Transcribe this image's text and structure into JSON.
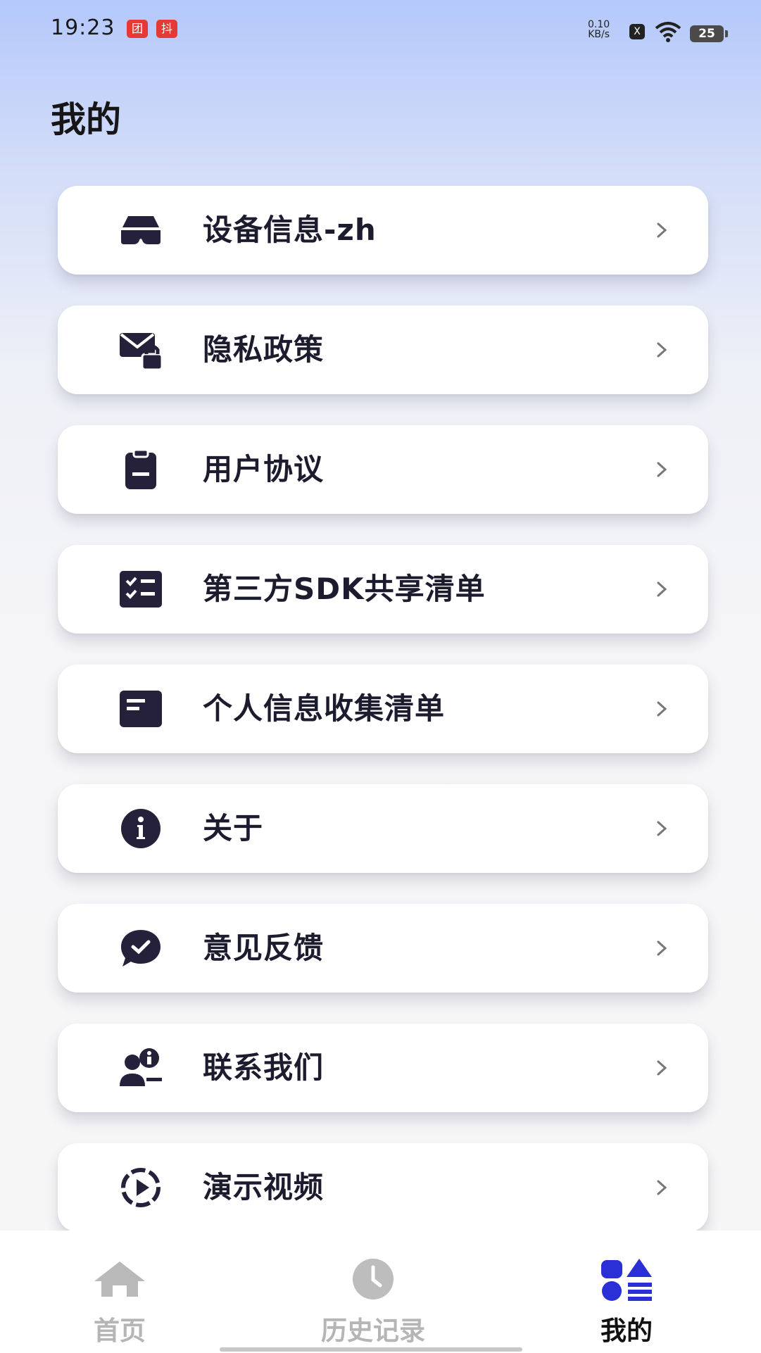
{
  "status_bar": {
    "time": "19:23",
    "notif_badges": [
      "团",
      "抖"
    ],
    "net_speed": "0.10",
    "net_unit": "KB/s",
    "sim_label": "X",
    "battery": "25"
  },
  "page": {
    "title": "我的"
  },
  "menu": [
    {
      "label": "设备信息-zh",
      "icon": "vr-headset-icon"
    },
    {
      "label": "隐私政策",
      "icon": "mail-lock-icon"
    },
    {
      "label": "用户协议",
      "icon": "clipboard-icon"
    },
    {
      "label": "第三方SDK共享清单",
      "icon": "checklist-icon"
    },
    {
      "label": "个人信息收集清单",
      "icon": "document-list-icon"
    },
    {
      "label": "关于",
      "icon": "info-icon"
    },
    {
      "label": "意见反馈",
      "icon": "chat-check-icon"
    },
    {
      "label": "联系我们",
      "icon": "contact-person-icon"
    },
    {
      "label": "演示视频",
      "icon": "video-play-icon"
    }
  ],
  "tabs": [
    {
      "label": "首页",
      "icon": "home-icon",
      "active": false
    },
    {
      "label": "历史记录",
      "icon": "clock-icon",
      "active": false
    },
    {
      "label": "我的",
      "icon": "profile-grid-icon",
      "active": true
    }
  ],
  "colors": {
    "icon_dark": "#25213b",
    "accent": "#2a2fd6",
    "tab_inactive": "#b5b5b5"
  }
}
